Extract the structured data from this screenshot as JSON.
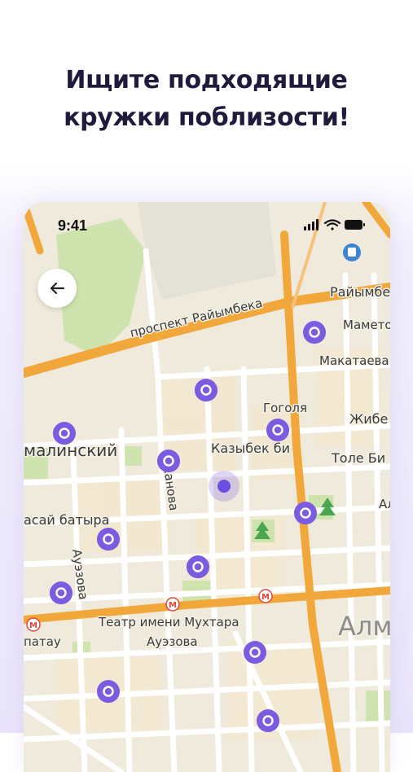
{
  "headline": {
    "line1": "Ищите подходящие",
    "line2": "кружки поблизости!"
  },
  "status_bar": {
    "time": "9:41",
    "icons": [
      "signal-icon",
      "wifi-icon",
      "battery-icon"
    ]
  },
  "back_button": {
    "icon": "arrow-left-icon"
  },
  "map": {
    "street_labels": {
      "raiymbek_avenue": "проспект Райымбека",
      "raiymbek_east": "Райымбе",
      "mametova": "Мамето",
      "makataeva": "Макатаева",
      "gogolya": "Гоголя",
      "zhibek": "Жибе",
      "kazybek_bi": "Казыбек би",
      "tole_bi": "Толе Би",
      "almalinsky": "малинский",
      "kabanbay": "асай батыра",
      "kanova": "канова",
      "auezova_vertical": "Ауэзова",
      "teatr": "Театр имени Мухтара",
      "auezova": "Ауэзова",
      "satpaev": "патау",
      "al": "Ал",
      "almaty": "Алм"
    },
    "user_location": "current-location-marker",
    "markers": [
      "map-pin-icon"
    ],
    "colors": {
      "pin": "#7b5ce0",
      "major_road": "#f2a73b",
      "park": "#cfe3ae",
      "metro": "#e5443a"
    }
  }
}
